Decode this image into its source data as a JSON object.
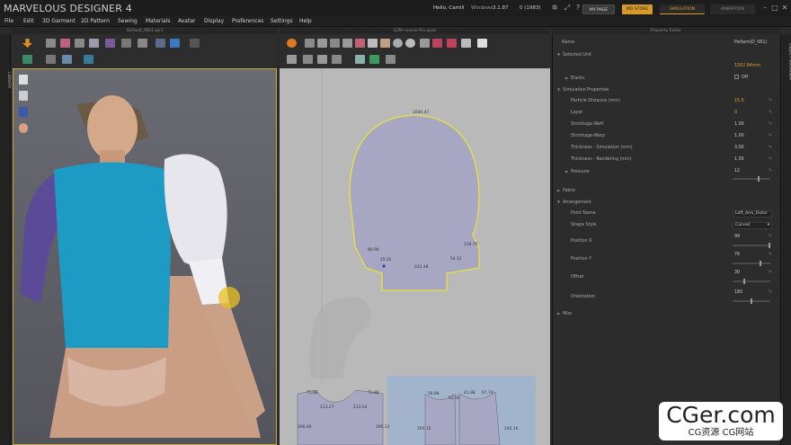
{
  "app": {
    "title": "MARVELOUS DESIGNER 4",
    "user_greeting": "Hello, Camili",
    "weight_label": "Windows",
    "weight_value": "3.1.87",
    "count_value": "0 (1983)",
    "my_page": "MY PAGE",
    "md_store": "MD STORE",
    "simulation": "SIMULATION",
    "animation": "ANIMATION"
  },
  "menu": [
    "File",
    "Edit",
    "3D Garment",
    "2D Pattern",
    "Sewing",
    "Materials",
    "Avatar",
    "Display",
    "Preferences",
    "Settings",
    "Help"
  ],
  "panes": {
    "view3d_title": "Default_MD4.zpr]",
    "view2d_title": "LDM-course-file.zpac",
    "property_title": "Property Editor",
    "library_tab": "LIBRARY",
    "object_browser_tab": "OBJECT BROWSER"
  },
  "pattern_labels": {
    "top": "1040.47",
    "left_shoulder": "80.90",
    "right_shoulder": "130.70",
    "left_under": "45.05",
    "right_under": "54.12",
    "bottom": "242.48",
    "b_l1": "71.88",
    "b_l2": "113.27",
    "b_l3": "113.54",
    "b_l4": "71.88",
    "b_l5": "296.46",
    "b_l6": "195.12",
    "b_r1": "59.88",
    "b_r2": "61.55",
    "b_r3": "67.70",
    "b_r4": "41.88",
    "b_r5": "195.16",
    "b_r6": "195.16"
  },
  "property": {
    "name_label": "Name",
    "name_value": "Pattern(D_061)",
    "selected_unit": "Selected Unit",
    "length_value": "1562.84mm",
    "elastic_label": "Elastic",
    "elastic_value": "Off",
    "simulation_properties": "Simulation Properties",
    "particle_label": "Particle Distance (mm)",
    "particle_value": "15.0",
    "layer_label": "Layer",
    "layer_value": "0",
    "shrink_w_label": "Shrinkage-Weft",
    "shrink_w_value": "1.00",
    "shrink_p_label": "Shrinkage-Warp",
    "shrink_p_value": "1.00",
    "thick_sim_label": "Thickness - Simulation (mm)",
    "thick_sim_value": "3.00",
    "thick_ren_label": "Thickness - Rendering (mm)",
    "thick_ren_value": "1.00",
    "pressure_label": "Pressure",
    "pressure_value": "12",
    "fabric_label": "Fabric",
    "arrangement_label": "Arrangement",
    "point_label": "Point Name",
    "point_value": "Left_Arm_Outer",
    "shape_label": "Shape Style",
    "shape_value": "Curved",
    "posx_label": "Position X",
    "posx_value": "99",
    "posy_label": "Position Y",
    "posy_value": "76",
    "offset_label": "Offset",
    "offset_value": "30",
    "orientation_label": "Orientation",
    "orientation_value": "180",
    "misc_label": "Misc",
    "pressure_level": 0.7,
    "posx_level": 0.99,
    "posy_level": 0.76,
    "offset_level": 0.3,
    "orientation_level": 0.5
  },
  "watermark": {
    "line1": "CGer.com",
    "line2": "CG资源 CG网站"
  },
  "colors": {
    "accent": "#e0a030",
    "shirt": "#1e9bc4",
    "pattern": "#a7a6c3",
    "highlight": "#e8e040"
  }
}
